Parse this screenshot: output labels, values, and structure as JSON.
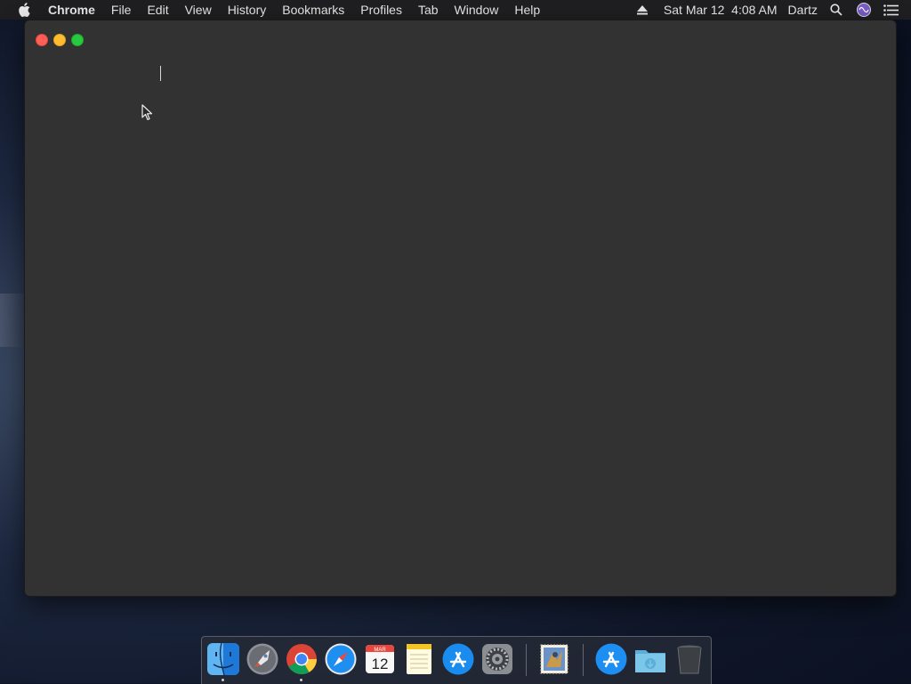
{
  "menubar": {
    "app_name": "Chrome",
    "menus": [
      "File",
      "Edit",
      "View",
      "History",
      "Bookmarks",
      "Profiles",
      "Tab",
      "Window",
      "Help"
    ],
    "datetime": "Sat Mar 12  4:08 AM",
    "user": "Dartz",
    "status_icons": [
      "eject-icon",
      "spotlight-search-icon",
      "siri-icon",
      "notification-center-icon"
    ]
  },
  "window": {
    "controls": [
      "close",
      "minimize",
      "zoom"
    ]
  },
  "dock": {
    "apps": [
      {
        "name": "Finder",
        "icon": "finder-icon",
        "running": true
      },
      {
        "name": "Launchpad",
        "icon": "launchpad-icon",
        "running": false
      },
      {
        "name": "Google Chrome",
        "icon": "chrome-icon",
        "running": true
      },
      {
        "name": "Safari",
        "icon": "safari-icon",
        "running": false
      },
      {
        "name": "Calendar",
        "icon": "calendar-icon",
        "running": false,
        "month": "MAR",
        "day": "12"
      },
      {
        "name": "Notes",
        "icon": "notes-icon",
        "running": false
      },
      {
        "name": "App Store",
        "icon": "app-store-icon",
        "running": false
      },
      {
        "name": "System Preferences",
        "icon": "system-preferences-icon",
        "running": false
      },
      {
        "name": "Mail",
        "icon": "mail-stamp-icon",
        "running": false
      },
      {
        "name": "Applications",
        "icon": "applications-folder-icon",
        "running": false
      },
      {
        "name": "Downloads",
        "icon": "downloads-folder-icon",
        "running": false
      },
      {
        "name": "Trash",
        "icon": "trash-icon",
        "running": false
      }
    ]
  },
  "colors": {
    "window_bg": "#323233",
    "menubar_bg": "#1f1f21",
    "close": "#fe5f57",
    "minimize": "#febc2e",
    "zoom": "#28c840"
  }
}
